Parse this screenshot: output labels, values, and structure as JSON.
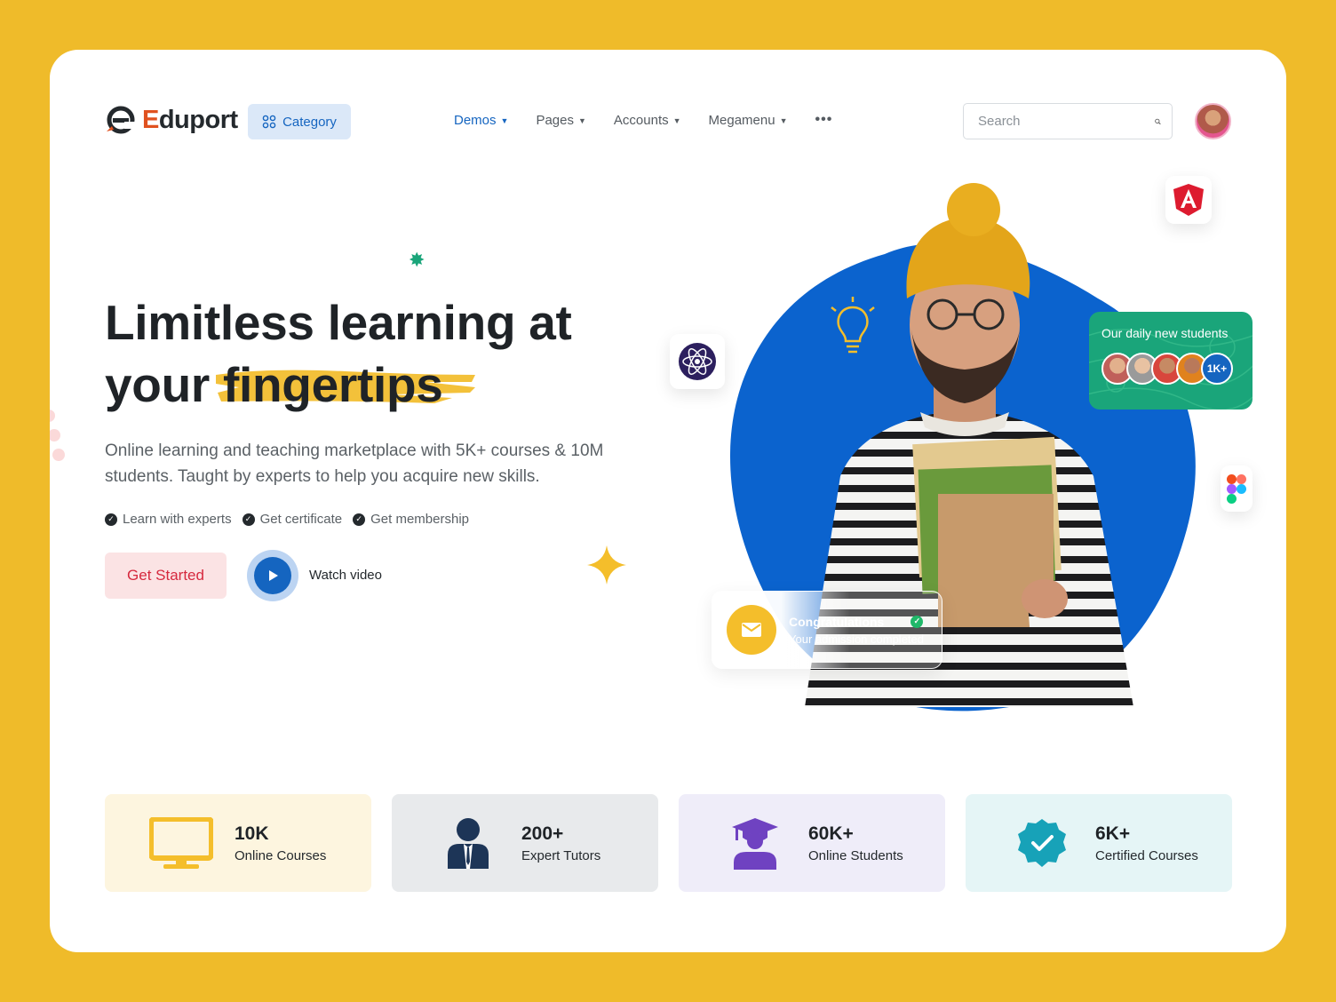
{
  "header": {
    "logo_text_prefix": "E",
    "logo_text_rest": "duport",
    "category_label": "Category",
    "nav": [
      {
        "label": "Demos"
      },
      {
        "label": "Pages"
      },
      {
        "label": "Accounts"
      },
      {
        "label": "Megamenu"
      }
    ],
    "more_label": "•••",
    "search_placeholder": "Search"
  },
  "hero": {
    "title_line1": "Limitless learning at",
    "title_word": "your",
    "title_highlight": "fingertips",
    "description": "Online learning and teaching marketplace with 5K+ courses & 10M students. Taught by experts to help you acquire new skills.",
    "features": [
      "Learn with experts",
      "Get certificate",
      "Get membership"
    ],
    "cta_label": "Get Started",
    "video_label": "Watch video"
  },
  "students_card": {
    "title": "Our daily new students",
    "more_count": "1K+"
  },
  "congrats_card": {
    "title": "Congratulations",
    "subtitle": "Your admission completed"
  },
  "stats": [
    {
      "value": "10K",
      "label": "Online Courses",
      "bg": "#fdf5df",
      "icon": "monitor-icon"
    },
    {
      "value": "200+",
      "label": "Expert Tutors",
      "bg": "#e8eaec",
      "icon": "tutor-icon"
    },
    {
      "value": "60K+",
      "label": "Online Students",
      "bg": "#efedf9",
      "icon": "graduate-icon"
    },
    {
      "value": "6K+",
      "label": "Certified Courses",
      "bg": "#e5f5f6",
      "icon": "verified-badge-icon"
    }
  ],
  "colors": {
    "page_bg": "#efbb2a",
    "primary": "#1565c0",
    "accent_red": "#d6293e",
    "accent_green": "#1aa57a",
    "accent_yellow": "#f4be2b"
  }
}
